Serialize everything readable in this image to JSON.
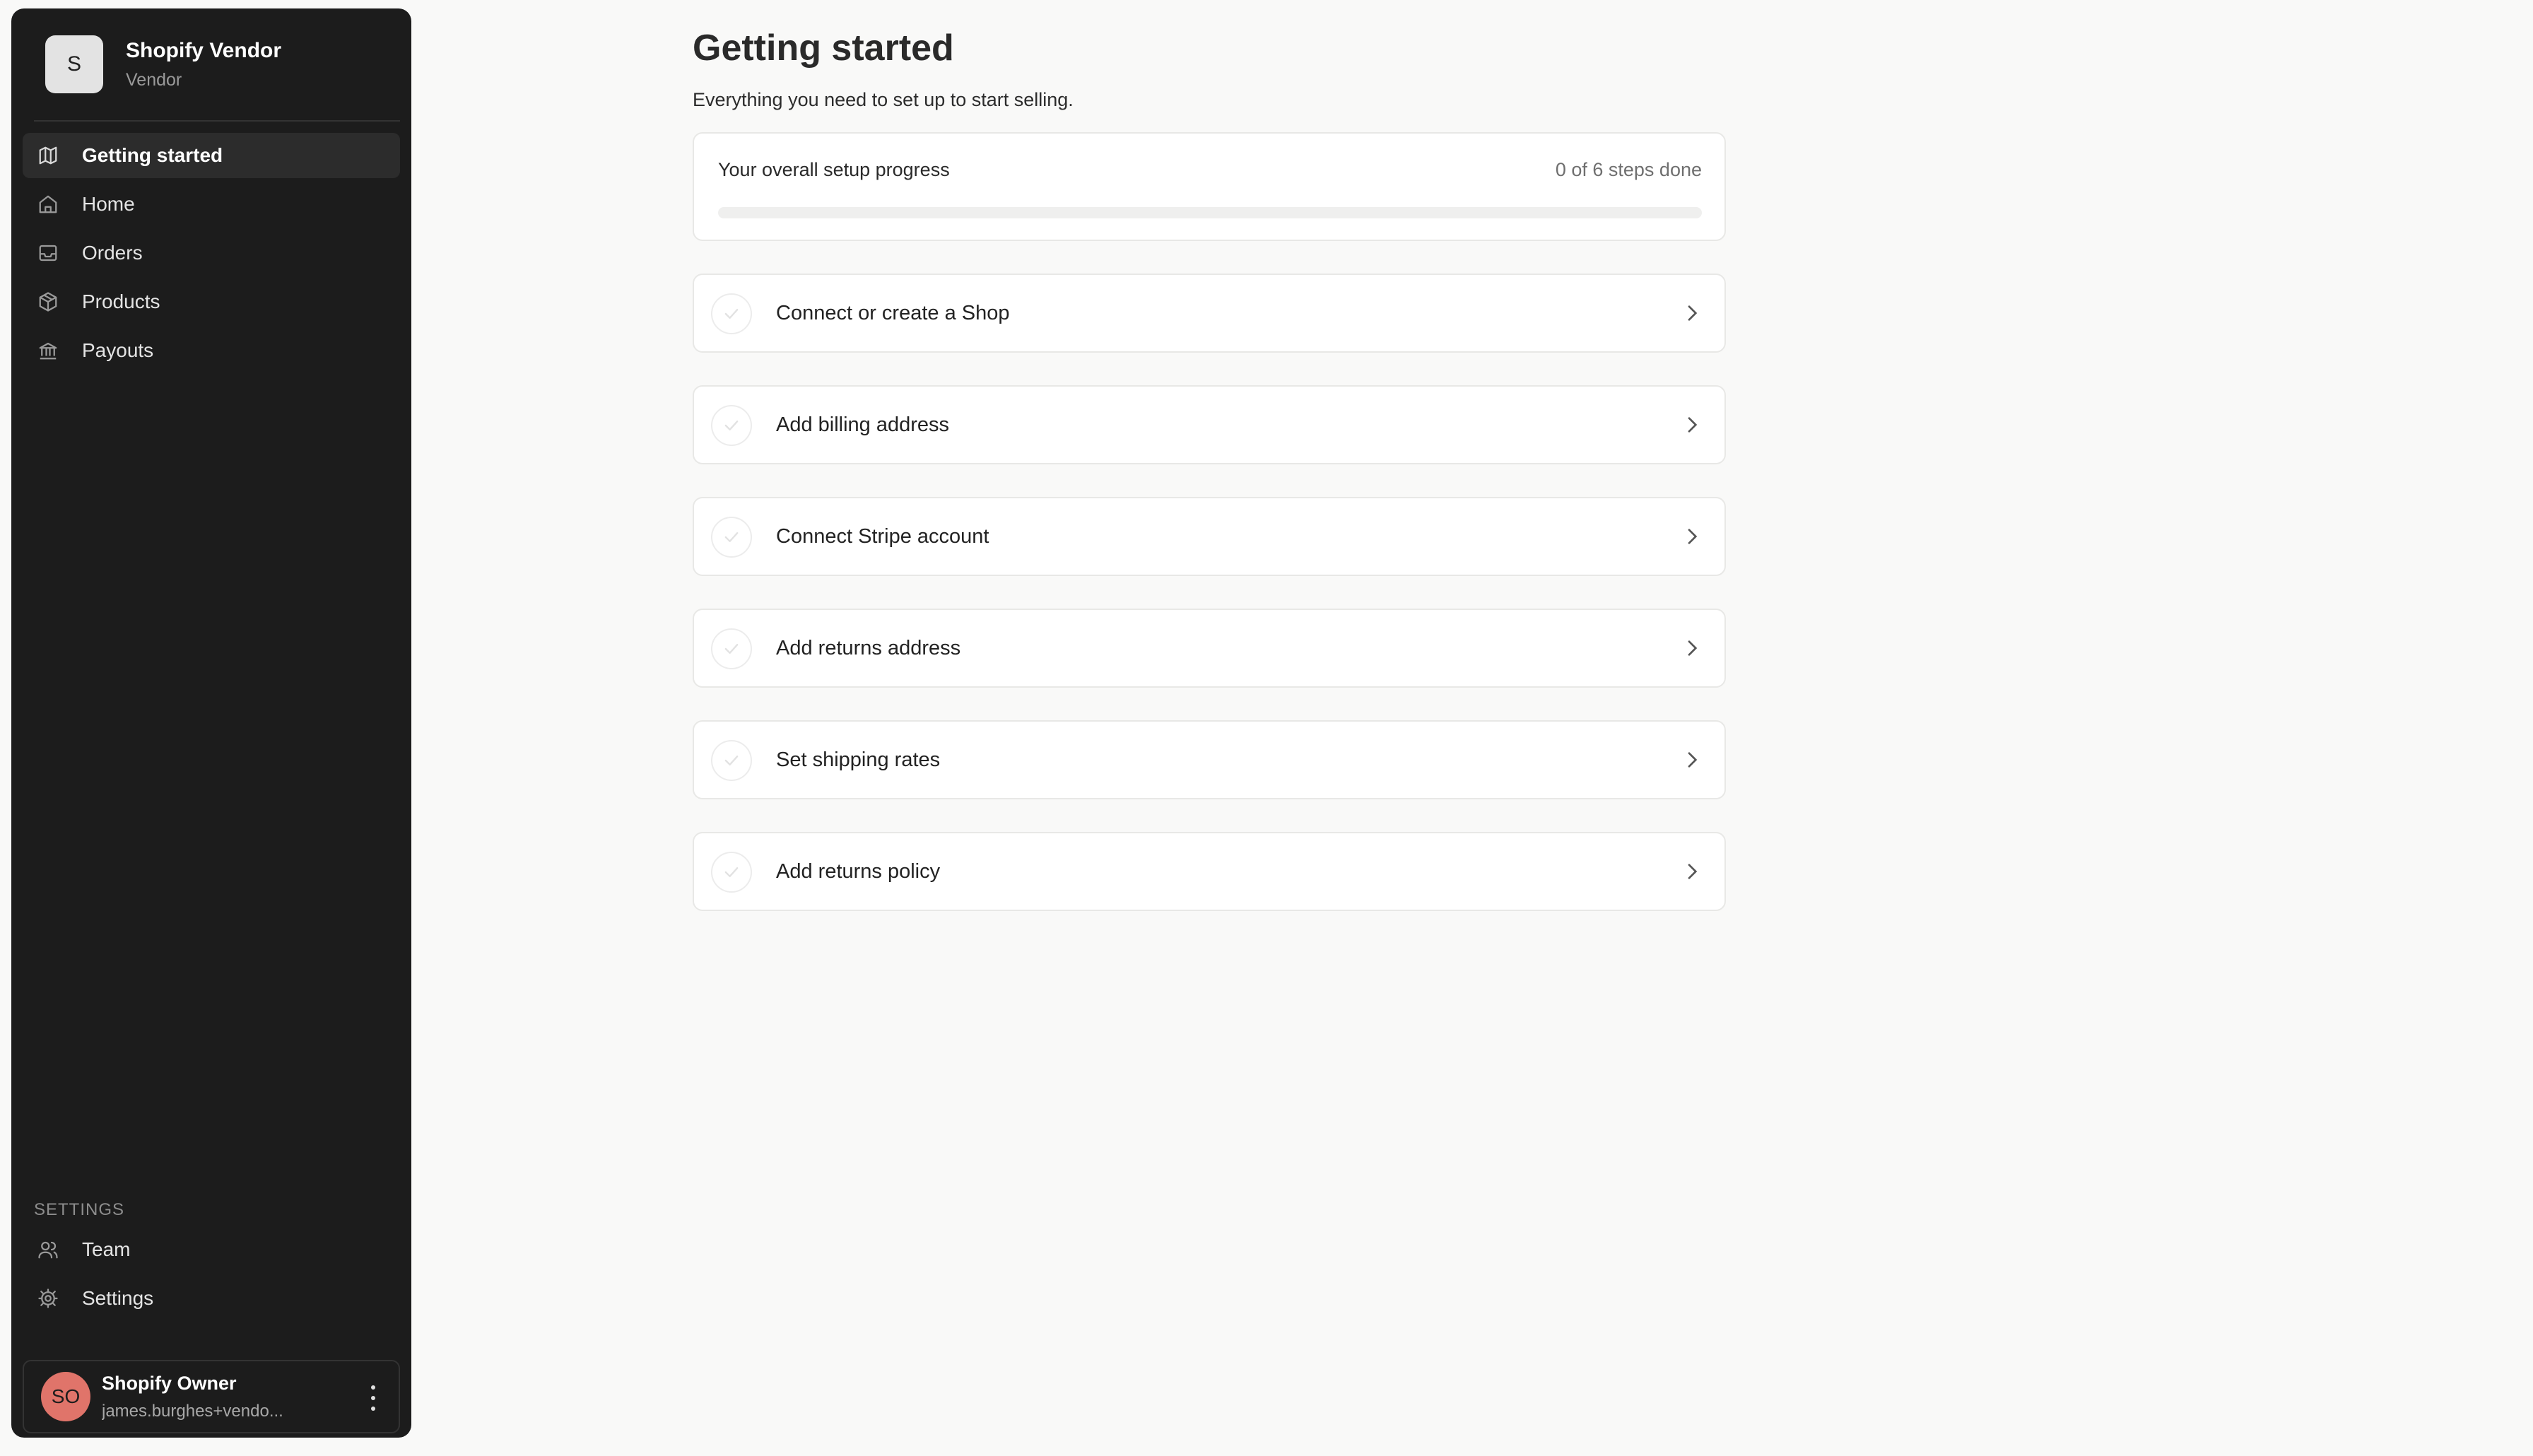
{
  "sidebar": {
    "brand": {
      "logo_letter": "S",
      "name": "Shopify Vendor",
      "role": "Vendor"
    },
    "nav": [
      {
        "label": "Getting started",
        "icon": "map-icon",
        "active": true
      },
      {
        "label": "Home",
        "icon": "home-icon",
        "active": false
      },
      {
        "label": "Orders",
        "icon": "inbox-icon",
        "active": false
      },
      {
        "label": "Products",
        "icon": "package-icon",
        "active": false
      },
      {
        "label": "Payouts",
        "icon": "bank-icon",
        "active": false
      }
    ],
    "settings_heading": "SETTINGS",
    "settings_nav": [
      {
        "label": "Team",
        "icon": "users-icon"
      },
      {
        "label": "Settings",
        "icon": "gear-icon"
      }
    ],
    "user": {
      "initials": "SO",
      "name": "Shopify Owner",
      "email": "james.burghes+vendo...",
      "avatar_color": "#e0746a"
    }
  },
  "main": {
    "title": "Getting started",
    "subtitle": "Everything you need to set up to start selling.",
    "progress": {
      "label": "Your overall setup progress",
      "count_text": "0 of 6 steps done",
      "fraction": 0
    },
    "steps": [
      {
        "label": "Connect or create a Shop",
        "done": false
      },
      {
        "label": "Add billing address",
        "done": false
      },
      {
        "label": "Connect Stripe account",
        "done": false
      },
      {
        "label": "Add returns address",
        "done": false
      },
      {
        "label": "Set shipping rates",
        "done": false
      },
      {
        "label": "Add returns policy",
        "done": false
      }
    ]
  },
  "colors": {
    "sidebar_bg": "#1c1c1c",
    "page_bg": "#f9f9f8",
    "card_border": "#e8e8e6"
  }
}
